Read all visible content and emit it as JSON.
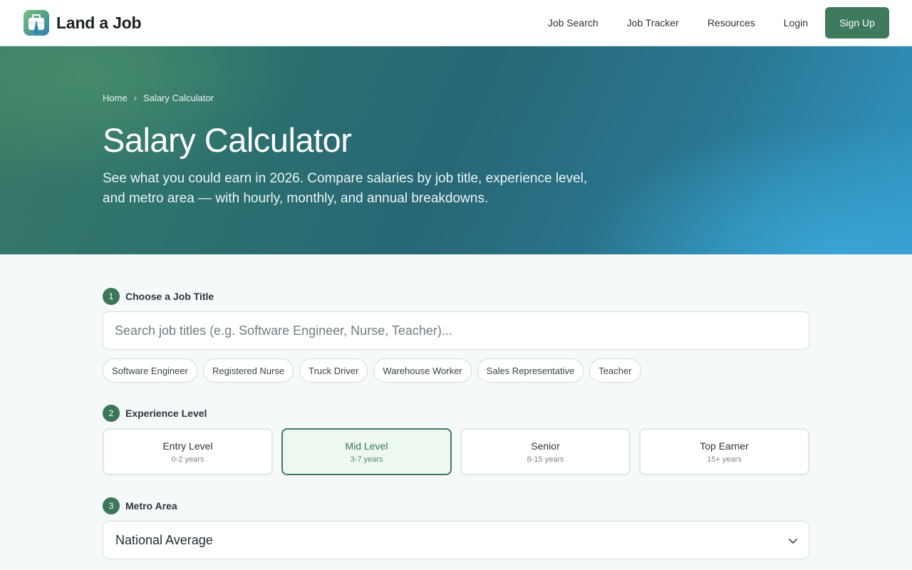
{
  "header": {
    "brand_name": "Land a Job",
    "nav": [
      {
        "label": "Job Search"
      },
      {
        "label": "Job Tracker"
      },
      {
        "label": "Resources"
      },
      {
        "label": "Login"
      }
    ],
    "signup_label": "Sign Up"
  },
  "hero": {
    "breadcrumb": {
      "home": "Home",
      "separator": "›",
      "current": "Salary Calculator"
    },
    "title": "Salary Calculator",
    "subtitle": "See what you could earn in 2026. Compare salaries by job title, experience level, and metro area — with hourly, monthly, and annual breakdowns."
  },
  "steps": {
    "job_title": {
      "number": "1",
      "label": "Choose a Job Title",
      "placeholder": "Search job titles (e.g. Software Engineer, Nurse, Teacher)...",
      "suggestions": [
        "Software Engineer",
        "Registered Nurse",
        "Truck Driver",
        "Warehouse Worker",
        "Sales Representative",
        "Teacher"
      ]
    },
    "experience": {
      "number": "2",
      "label": "Experience Level",
      "options": [
        {
          "title": "Entry Level",
          "years": "0-2 years"
        },
        {
          "title": "Mid Level",
          "years": "3-7 years"
        },
        {
          "title": "Senior",
          "years": "8-15 years"
        },
        {
          "title": "Top Earner",
          "years": "15+ years"
        }
      ],
      "selected": "Mid Level"
    },
    "metro": {
      "number": "3",
      "label": "Metro Area",
      "selected_value": "National Average"
    }
  },
  "colors": {
    "accent": "#3e7a5e",
    "selected_bg": "#ecf8f0",
    "hero_start": "#3a7c66",
    "hero_end": "#3196c6"
  }
}
